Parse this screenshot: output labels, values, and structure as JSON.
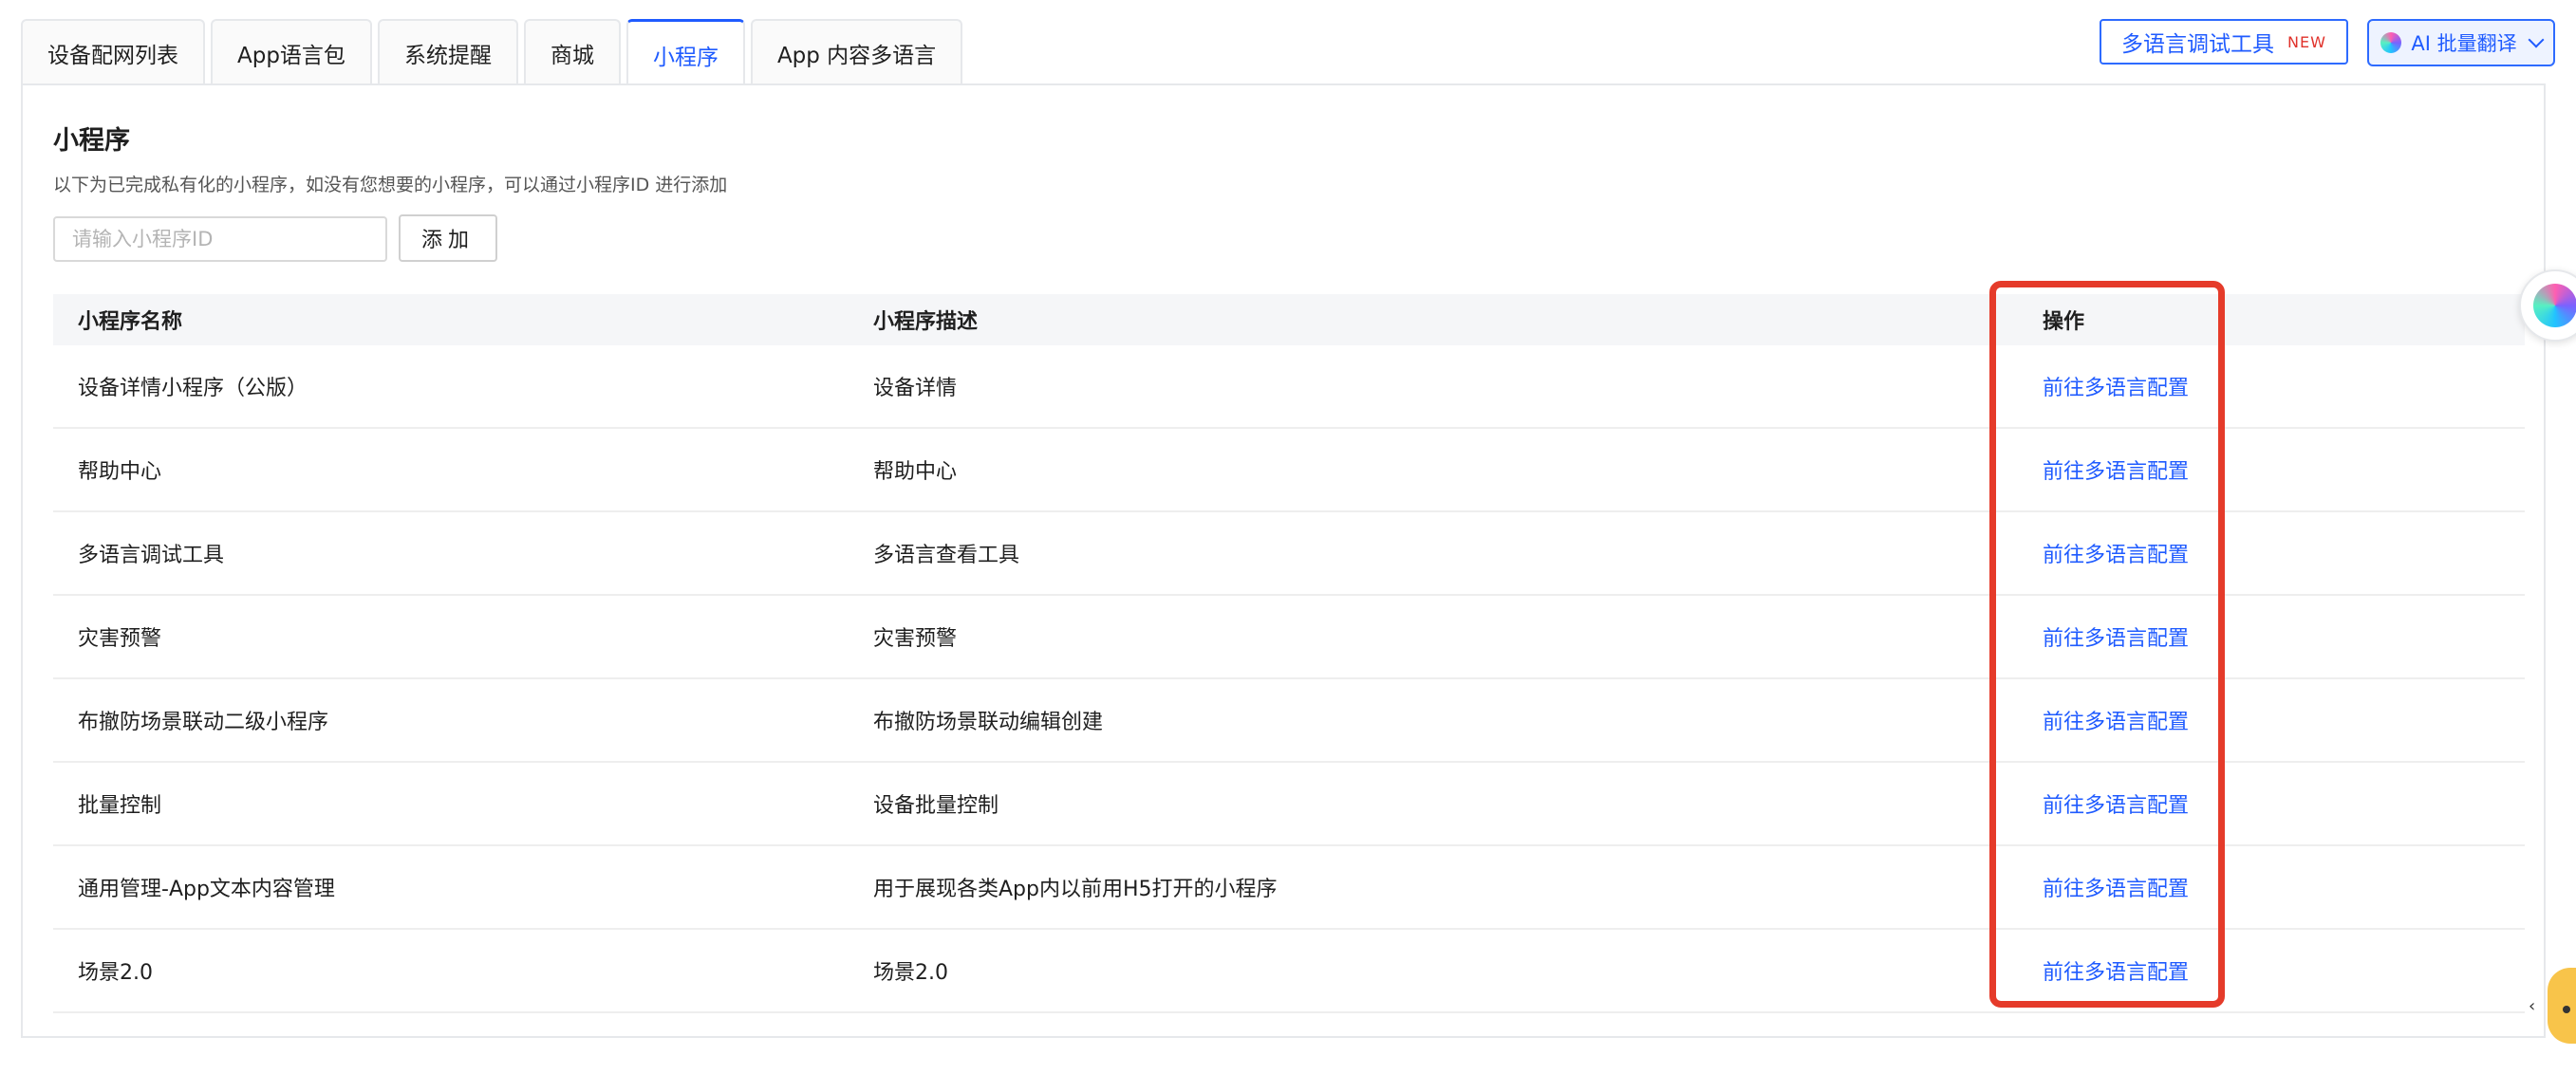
{
  "tabs": [
    {
      "label": "设备配网列表",
      "active": false
    },
    {
      "label": "App语言包",
      "active": false
    },
    {
      "label": "系统提醒",
      "active": false
    },
    {
      "label": "商城",
      "active": false
    },
    {
      "label": "小程序",
      "active": true
    },
    {
      "label": "App 内容多语言",
      "active": false
    }
  ],
  "toolbar": {
    "debug_tool_label": "多语言调试工具",
    "debug_tool_badge": "NEW",
    "ai_translate_label": "AI 批量翻译"
  },
  "section": {
    "title": "小程序",
    "description": "以下为已完成私有化的小程序，如没有您想要的小程序，可以通过小程序ID 进行添加"
  },
  "search": {
    "placeholder": "请输入小程序ID",
    "value": "",
    "add_label": "添加"
  },
  "table": {
    "headers": [
      "小程序名称",
      "小程序描述",
      "操作"
    ],
    "rows": [
      {
        "name": "设备详情小程序（公版）",
        "desc": "设备详情",
        "action": "前往多语言配置"
      },
      {
        "name": "帮助中心",
        "desc": "帮助中心",
        "action": "前往多语言配置"
      },
      {
        "name": "多语言调试工具",
        "desc": "多语言查看工具",
        "action": "前往多语言配置"
      },
      {
        "name": "灾害预警",
        "desc": "灾害预警",
        "action": "前往多语言配置"
      },
      {
        "name": "布撤防场景联动二级小程序",
        "desc": "布撤防场景联动编辑创建",
        "action": "前往多语言配置"
      },
      {
        "name": "批量控制",
        "desc": "设备批量控制",
        "action": "前往多语言配置"
      },
      {
        "name": "通用管理-App文本内容管理",
        "desc": "用于展现各类App内以前用H5打开的小程序",
        "action": "前往多语言配置"
      },
      {
        "name": "场景2.0",
        "desc": "场景2.0",
        "action": "前往多语言配置"
      }
    ]
  },
  "colors": {
    "accent": "#1f5bff",
    "highlight": "#e53b2a",
    "badge": "#e0322b"
  },
  "icons": {
    "ai_orb": "ai-assistant-icon",
    "dropdown": "chevron-down-icon",
    "mascot": "mascot-icon"
  }
}
